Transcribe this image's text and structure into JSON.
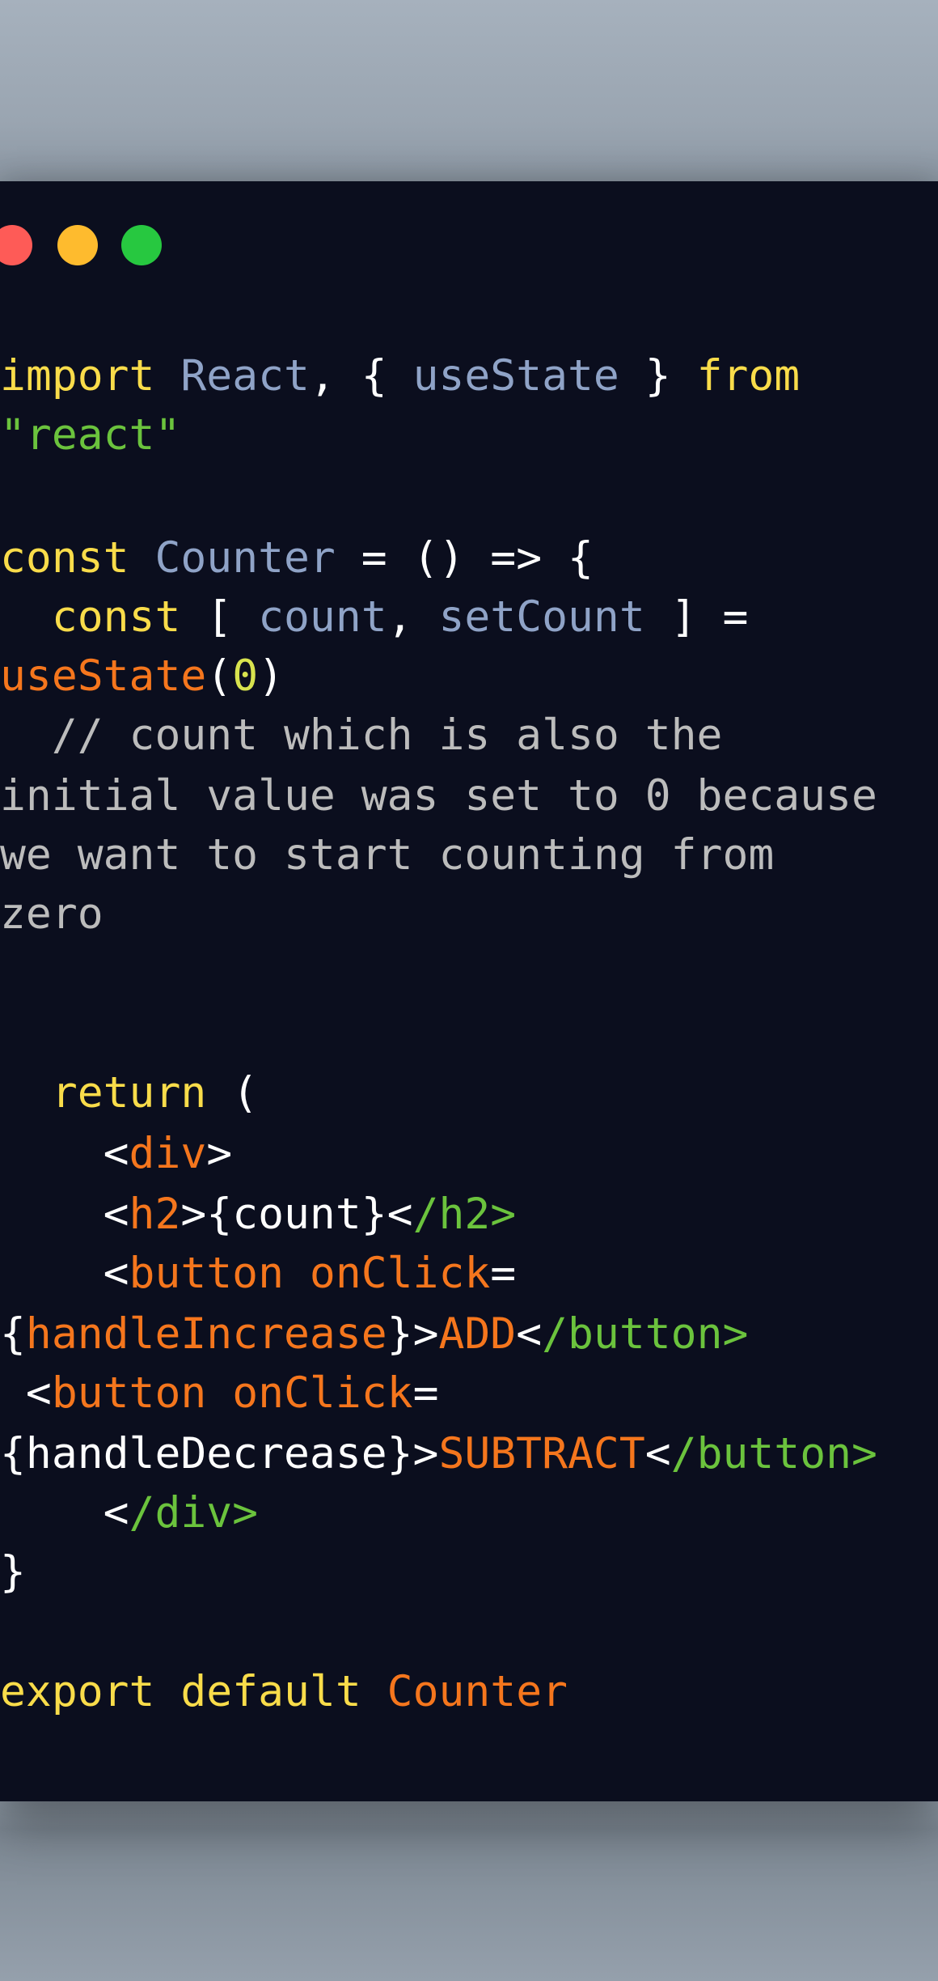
{
  "window": {
    "traffic_lights": [
      {
        "name": "close",
        "color": "#fe5b57"
      },
      {
        "name": "minimize",
        "color": "#febb2e"
      },
      {
        "name": "zoom",
        "color": "#27c840"
      }
    ]
  },
  "colors": {
    "background": "#0b0e1e",
    "keyword": "#f9dc4a",
    "identifier": "#8fa3c7",
    "string": "#6bc33d",
    "number": "#d8e34e",
    "function": "#f5761d",
    "comment": "#bcbcbc",
    "plain": "#ffffff"
  },
  "code": {
    "lines": [
      [
        {
          "t": "import",
          "c": "keyword"
        },
        {
          "t": " ",
          "c": "plain"
        },
        {
          "t": "React",
          "c": "identifier"
        },
        {
          "t": ", { ",
          "c": "plain"
        },
        {
          "t": "useState",
          "c": "identifier"
        },
        {
          "t": " } ",
          "c": "plain"
        },
        {
          "t": "from",
          "c": "keyword"
        }
      ],
      [
        {
          "t": "\"react\"",
          "c": "string"
        }
      ],
      [],
      [
        {
          "t": "const",
          "c": "keyword"
        },
        {
          "t": " ",
          "c": "plain"
        },
        {
          "t": "Counter",
          "c": "identifier"
        },
        {
          "t": " = () => {",
          "c": "plain"
        }
      ],
      [
        {
          "t": "  ",
          "c": "plain"
        },
        {
          "t": "const",
          "c": "keyword"
        },
        {
          "t": " [ ",
          "c": "plain"
        },
        {
          "t": "count",
          "c": "identifier"
        },
        {
          "t": ", ",
          "c": "plain"
        },
        {
          "t": "setCount",
          "c": "identifier"
        },
        {
          "t": " ] =",
          "c": "plain"
        }
      ],
      [
        {
          "t": "useState",
          "c": "function"
        },
        {
          "t": "(",
          "c": "plain"
        },
        {
          "t": "0",
          "c": "number"
        },
        {
          "t": ")",
          "c": "plain"
        }
      ],
      [
        {
          "t": "  // count which is also the",
          "c": "comment"
        }
      ],
      [
        {
          "t": "initial value was set to 0 because",
          "c": "comment"
        }
      ],
      [
        {
          "t": "we want to start counting from",
          "c": "comment"
        }
      ],
      [
        {
          "t": "zero",
          "c": "comment"
        }
      ],
      [],
      [],
      [
        {
          "t": "  ",
          "c": "plain"
        },
        {
          "t": "return",
          "c": "keyword"
        },
        {
          "t": " (",
          "c": "plain"
        }
      ],
      [
        {
          "t": "    <",
          "c": "plain"
        },
        {
          "t": "div",
          "c": "function"
        },
        {
          "t": ">",
          "c": "plain"
        }
      ],
      [
        {
          "t": "    <",
          "c": "plain"
        },
        {
          "t": "h2",
          "c": "function"
        },
        {
          "t": ">{count}<",
          "c": "plain"
        },
        {
          "t": "/h2>",
          "c": "string"
        }
      ],
      [
        {
          "t": "    <",
          "c": "plain"
        },
        {
          "t": "button onClick",
          "c": "function"
        },
        {
          "t": "=",
          "c": "plain"
        }
      ],
      [
        {
          "t": "{",
          "c": "plain"
        },
        {
          "t": "handleIncrease",
          "c": "function"
        },
        {
          "t": "}>",
          "c": "plain"
        },
        {
          "t": "ADD",
          "c": "function"
        },
        {
          "t": "<",
          "c": "plain"
        },
        {
          "t": "/button>",
          "c": "string"
        }
      ],
      [
        {
          "t": " <",
          "c": "plain"
        },
        {
          "t": "button onClick",
          "c": "function"
        },
        {
          "t": "=",
          "c": "plain"
        }
      ],
      [
        {
          "t": "{handleDecrease}>",
          "c": "plain"
        },
        {
          "t": "SUBTRACT",
          "c": "function"
        },
        {
          "t": "<",
          "c": "plain"
        },
        {
          "t": "/button>",
          "c": "string"
        }
      ],
      [
        {
          "t": "    <",
          "c": "plain"
        },
        {
          "t": "/div>",
          "c": "string"
        }
      ],
      [
        {
          "t": "}",
          "c": "plain"
        }
      ],
      [],
      [
        {
          "t": "export default",
          "c": "keyword"
        },
        {
          "t": " ",
          "c": "plain"
        },
        {
          "t": "Counter",
          "c": "function"
        }
      ]
    ]
  }
}
